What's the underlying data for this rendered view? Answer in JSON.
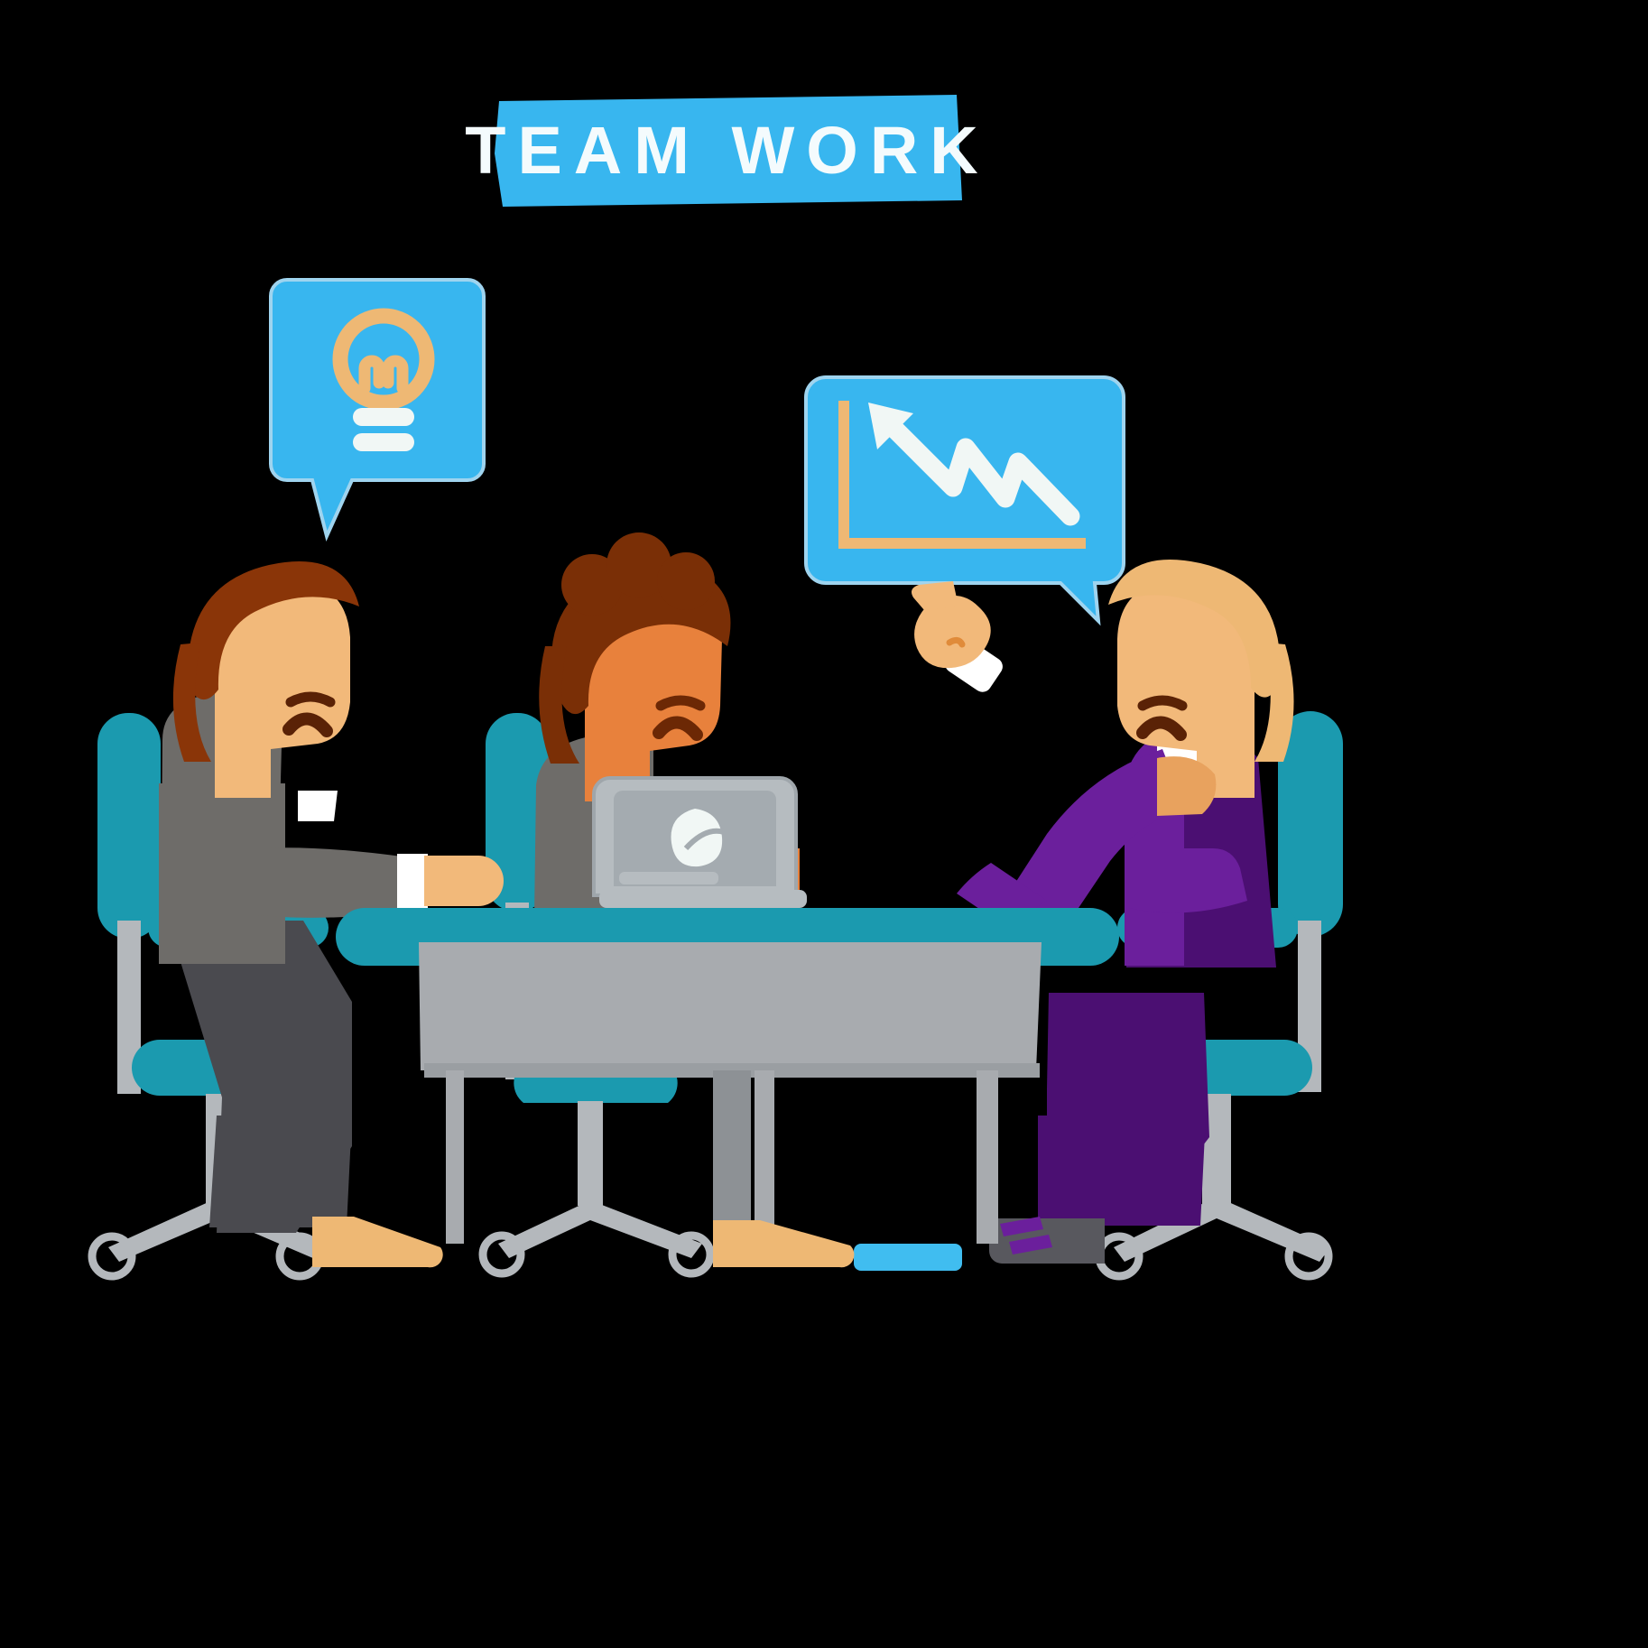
{
  "scene": {
    "title": "TEAM WORK",
    "background_color": "#000000",
    "description": "Flat illustration of three businessmen at a conference table with speech bubbles"
  },
  "banner": {
    "label": "TEAM WORK",
    "fill_color": "#38b6ef",
    "text_color": "#f4fbfd"
  },
  "bubbles": [
    {
      "name": "idea-bubble",
      "icon": "lightbulb-icon",
      "fill_color": "#38b6ef",
      "icon_color": "#eeb874",
      "base_color": "#f1f7f5"
    },
    {
      "name": "chart-bubble",
      "icon": "declining-chart-icon",
      "fill_color": "#38b6ef",
      "axis_color": "#eeb874",
      "arrow_color": "#f1f7f5"
    }
  ],
  "people": [
    {
      "name": "person-left",
      "hair_color": "#8a3508",
      "skin_color": "#f2b97a",
      "suit_color": "#6e6c69",
      "shirt_color": "#ffffff",
      "trousers_color": "#4a4a4f",
      "shoe_color": "#eeb874",
      "pose": "seated-facing-right-smiling"
    },
    {
      "name": "person-center",
      "hair_color": "#7a2f06",
      "skin_color": "#e8813c",
      "suit_color": "#6e6c69",
      "shirt_color": "#ffffff",
      "trousers_color": "#4a4a4f",
      "shoe_color": "#eeb874",
      "pose": "seated-facing-right-at-laptop"
    },
    {
      "name": "person-right",
      "hair_color": "#eeb874",
      "skin_color": "#f2b97a",
      "suit_color": "#6b1f9c",
      "shirt_color": "#ffffff",
      "trousers_color": "#4b0f72",
      "shoe_color": "#58585e",
      "pose": "seated-facing-left-pointing"
    }
  ],
  "furniture": {
    "desk_top_color": "#1b9aaf",
    "desk_body_color": "#a8abaf",
    "chair_color": "#1b9aaf",
    "chair_frame_color": "#b4b8bc",
    "laptop_body_color": "#b6bcc0",
    "laptop_screen_color": "#a4abb0",
    "laptop_logo": "leaf-logo"
  },
  "palette": {
    "sky_blue": "#38b6ef",
    "teal": "#1b9aaf",
    "tan": "#eeb874",
    "purple": "#6b1f9c",
    "grey_suit": "#6e6c69",
    "light_grey": "#b4b8bc",
    "off_white": "#f1f7f5",
    "skin": "#f2b97a",
    "skin_dark": "#e8813c",
    "hair_brown": "#8a3508",
    "outline": "#aacfe4"
  }
}
